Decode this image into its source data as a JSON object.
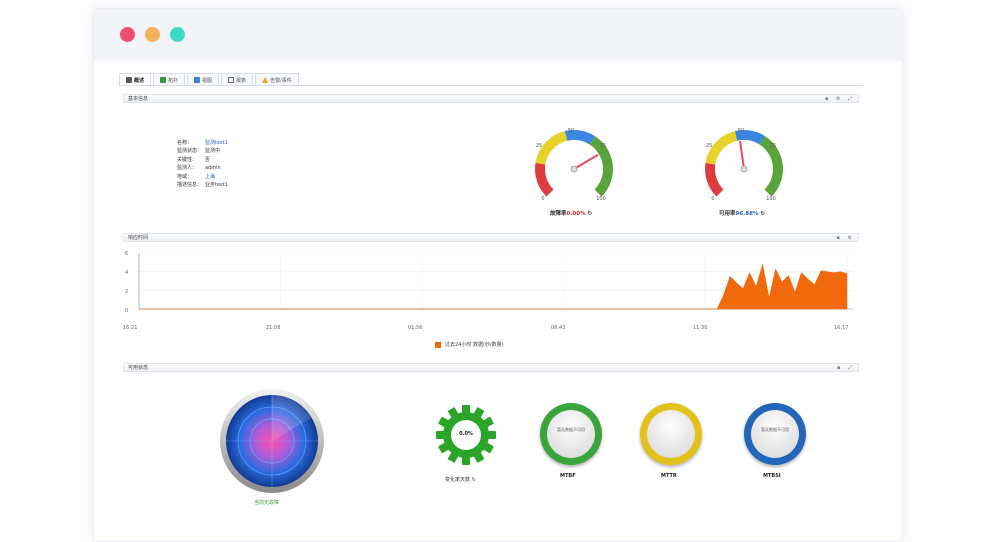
{
  "window": {
    "dots": [
      "#f0506e",
      "#f5b25c",
      "#3ed8c8"
    ]
  },
  "tabs": [
    {
      "label": "概述",
      "active": true
    },
    {
      "label": "拓扑",
      "active": false
    },
    {
      "label": "视图",
      "active": false
    },
    {
      "label": "报表",
      "active": false
    },
    {
      "label": "告警/事件",
      "active": false
    }
  ],
  "basic": {
    "title": "基本信息",
    "controls": "▪ ⚙ ⤢",
    "fields": [
      {
        "k": "名称：",
        "v": "监测test1"
      },
      {
        "k": "监测状态：",
        "v": "监测中"
      },
      {
        "k": "关键性：",
        "v": "否"
      },
      {
        "k": "监测人：",
        "v": "admin"
      },
      {
        "k": "地域：",
        "v": "上海"
      },
      {
        "k": "描述信息：",
        "v": "业务test1"
      }
    ]
  },
  "gauges": [
    {
      "label": "故障率",
      "value": "0.00%",
      "ticks": [
        "0",
        "25",
        "50",
        "75",
        "100"
      ],
      "needle": 0.72
    },
    {
      "label": "可用率",
      "value": "96.88%",
      "ticks": [
        "0",
        "25",
        "50",
        "75",
        "100"
      ],
      "needle": 0.47
    }
  ],
  "chart_section": {
    "title": "响应时间",
    "controls": "▪ ⚙"
  },
  "chart_data": {
    "type": "area",
    "title": "",
    "xlabel": "",
    "ylabel": "",
    "x_ticks": [
      "16:21",
      "21:08",
      "01:56",
      "06:43",
      "11:30",
      "16:17"
    ],
    "y_ticks": [
      "6",
      "4",
      "2",
      "0"
    ],
    "ylim": [
      0,
      6
    ],
    "series": [
      {
        "name": "过去24小时 数据(秒/数量)",
        "color": "#f06a0c",
        "values": [
          0,
          0,
          0,
          0,
          0,
          0,
          0,
          0,
          0,
          0,
          0,
          0,
          0,
          0,
          0,
          0,
          0,
          0,
          0,
          0,
          0,
          0,
          0,
          0,
          0,
          0,
          0,
          0,
          0,
          0,
          0,
          0,
          0,
          0,
          0,
          0,
          0,
          0,
          0,
          0,
          0,
          0,
          0,
          0,
          0,
          0,
          0,
          0,
          0,
          0,
          0,
          0,
          0,
          0,
          0,
          0,
          0,
          0,
          0,
          0,
          0,
          0,
          0,
          0,
          0,
          0,
          0,
          0,
          0,
          0,
          0,
          0,
          0,
          0,
          0,
          0,
          0,
          0,
          0,
          0,
          0,
          0,
          0,
          0,
          0,
          0,
          0,
          0,
          0,
          0,
          1.5,
          3.5,
          2.8,
          2.2,
          3.9,
          2.4,
          4.8,
          1.2,
          4.3,
          2.9,
          3.6,
          1.8,
          3.9,
          3.2,
          2.6,
          4.1,
          4.0,
          3.9,
          4.0,
          3.8
        ]
      }
    ]
  },
  "status": {
    "title": "可用状态",
    "controls": "▪ ⤢",
    "radar_label": "当前无故障",
    "gear": {
      "value": "0.0%",
      "label": "变化率天数"
    },
    "rings": [
      {
        "label": "MTBF",
        "inner": "暂无数据不可用",
        "color": "#3aa53a"
      },
      {
        "label": "MTTR",
        "inner": "",
        "color": "#e2c21a"
      },
      {
        "label": "MTBSI",
        "inner": "暂无数据不可用",
        "color": "#2166b8"
      }
    ]
  }
}
